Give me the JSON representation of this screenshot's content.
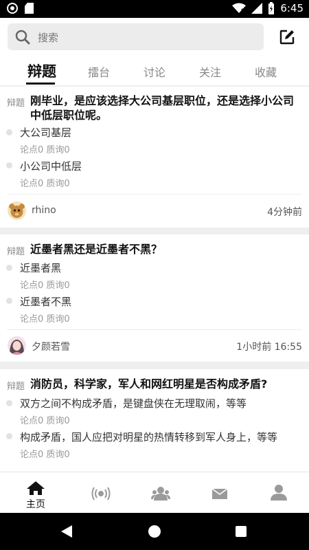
{
  "status_bar": {
    "time": "6:45"
  },
  "header": {
    "search_placeholder": "搜索",
    "tabs": [
      "辩题",
      "擂台",
      "讨论",
      "关注",
      "收藏"
    ]
  },
  "posts": [
    {
      "badge": "辩题",
      "title": "刚毕业，是应该选择大公司基层职位，还是选择小公司中低层职位呢。",
      "options": [
        {
          "text": "大公司基层",
          "meta": "论点0 质询0"
        },
        {
          "text": "小公司中低层",
          "meta": "论点0 质询0"
        }
      ],
      "author": "rhino",
      "time": "4分钟前"
    },
    {
      "badge": "辩题",
      "title": "近墨者黑还是近墨者不黑？",
      "options": [
        {
          "text": "近墨者黑",
          "meta": "论点0 质询0"
        },
        {
          "text": "近墨者不黑",
          "meta": "论点0 质询0"
        }
      ],
      "author": "夕颜若雪",
      "time": "1小时前 16:55"
    },
    {
      "badge": "辩题",
      "title": "消防员，科学家，军人和网红明星是否构成矛盾?",
      "options": [
        {
          "text": "双方之间不构成矛盾，是键盘侠在无理取闹，等等",
          "meta": "论点0 质询0"
        },
        {
          "text": "构成矛盾，国人应把对明星的热情转移到军人身上，等等",
          "meta": "论点0 质询0"
        }
      ]
    }
  ],
  "bottom_nav": {
    "home_label": "主页",
    "items": [
      "home-icon",
      "broadcast-icon",
      "group-icon",
      "mail-icon",
      "profile-icon"
    ]
  },
  "colors": {
    "accent": "#111111",
    "inactive": "#9a9a9a",
    "background": "#efefef"
  }
}
